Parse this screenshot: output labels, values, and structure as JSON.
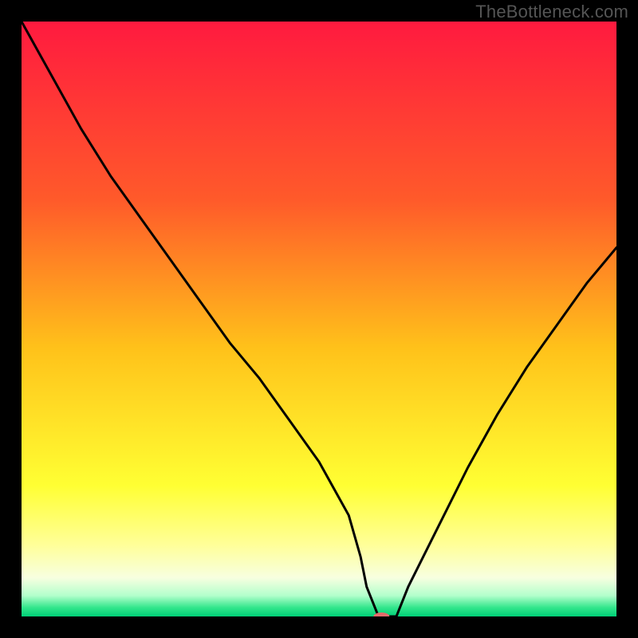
{
  "watermark": "TheBottleneck.com",
  "chart_data": {
    "type": "line",
    "title": "",
    "xlabel": "",
    "ylabel": "",
    "xlim": [
      0,
      100
    ],
    "ylim": [
      0,
      100
    ],
    "background_gradient": [
      {
        "offset": 0.0,
        "color": "#ff1a3f"
      },
      {
        "offset": 0.3,
        "color": "#ff5a2a"
      },
      {
        "offset": 0.55,
        "color": "#ffc21a"
      },
      {
        "offset": 0.78,
        "color": "#ffff33"
      },
      {
        "offset": 0.88,
        "color": "#ffff99"
      },
      {
        "offset": 0.935,
        "color": "#f7ffe0"
      },
      {
        "offset": 0.965,
        "color": "#b3ffcc"
      },
      {
        "offset": 0.985,
        "color": "#33e68c"
      },
      {
        "offset": 1.0,
        "color": "#00d077"
      }
    ],
    "series": [
      {
        "name": "bottleneck-curve",
        "x": [
          0,
          5,
          10,
          15,
          20,
          25,
          30,
          35,
          40,
          45,
          50,
          55,
          57,
          58,
          60,
          61,
          63,
          65,
          70,
          75,
          80,
          85,
          90,
          95,
          100
        ],
        "y": [
          100,
          91,
          82,
          74,
          67,
          60,
          53,
          46,
          40,
          33,
          26,
          17,
          10,
          5,
          0,
          0,
          0,
          5,
          15,
          25,
          34,
          42,
          49,
          56,
          62
        ]
      }
    ],
    "marker": {
      "name": "optimum-marker",
      "x": 60.5,
      "y": 0,
      "color": "#e36b6b",
      "rx": 10,
      "ry": 5
    }
  }
}
